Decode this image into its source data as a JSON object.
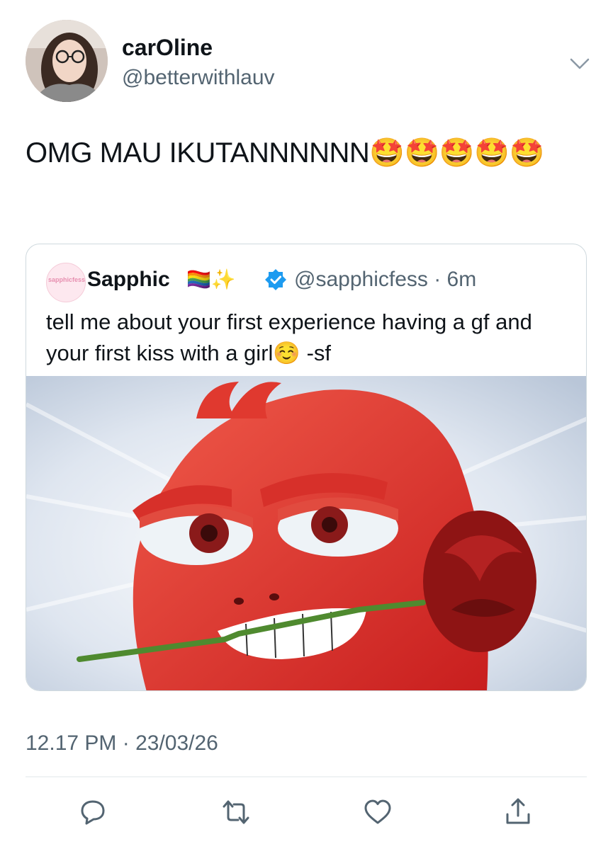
{
  "author": {
    "display_name": "carOline",
    "handle": "@betterwithlauv"
  },
  "tweet": {
    "text": "OMG MAU IKUTANNNNNN🤩🤩🤩🤩🤩",
    "timestamp": "12.17 PM · 23/03/26"
  },
  "quoted": {
    "display_name": "Sapphic",
    "name_emojis": "🏳️‍🌈✨",
    "handle_time": "@sapphicfess · 6m",
    "text": "tell me about your first experience having a gf and your first kiss with a girl☺️ -sf",
    "avatar_text": "sapphicfess"
  },
  "actions": [
    {
      "icon": "reply-icon"
    },
    {
      "icon": "retweet-icon"
    },
    {
      "icon": "like-icon"
    },
    {
      "icon": "share-icon"
    }
  ],
  "colors": {
    "secondary_text": "#536471",
    "verified": "#1d9bf0",
    "border": "#cfd9de"
  }
}
